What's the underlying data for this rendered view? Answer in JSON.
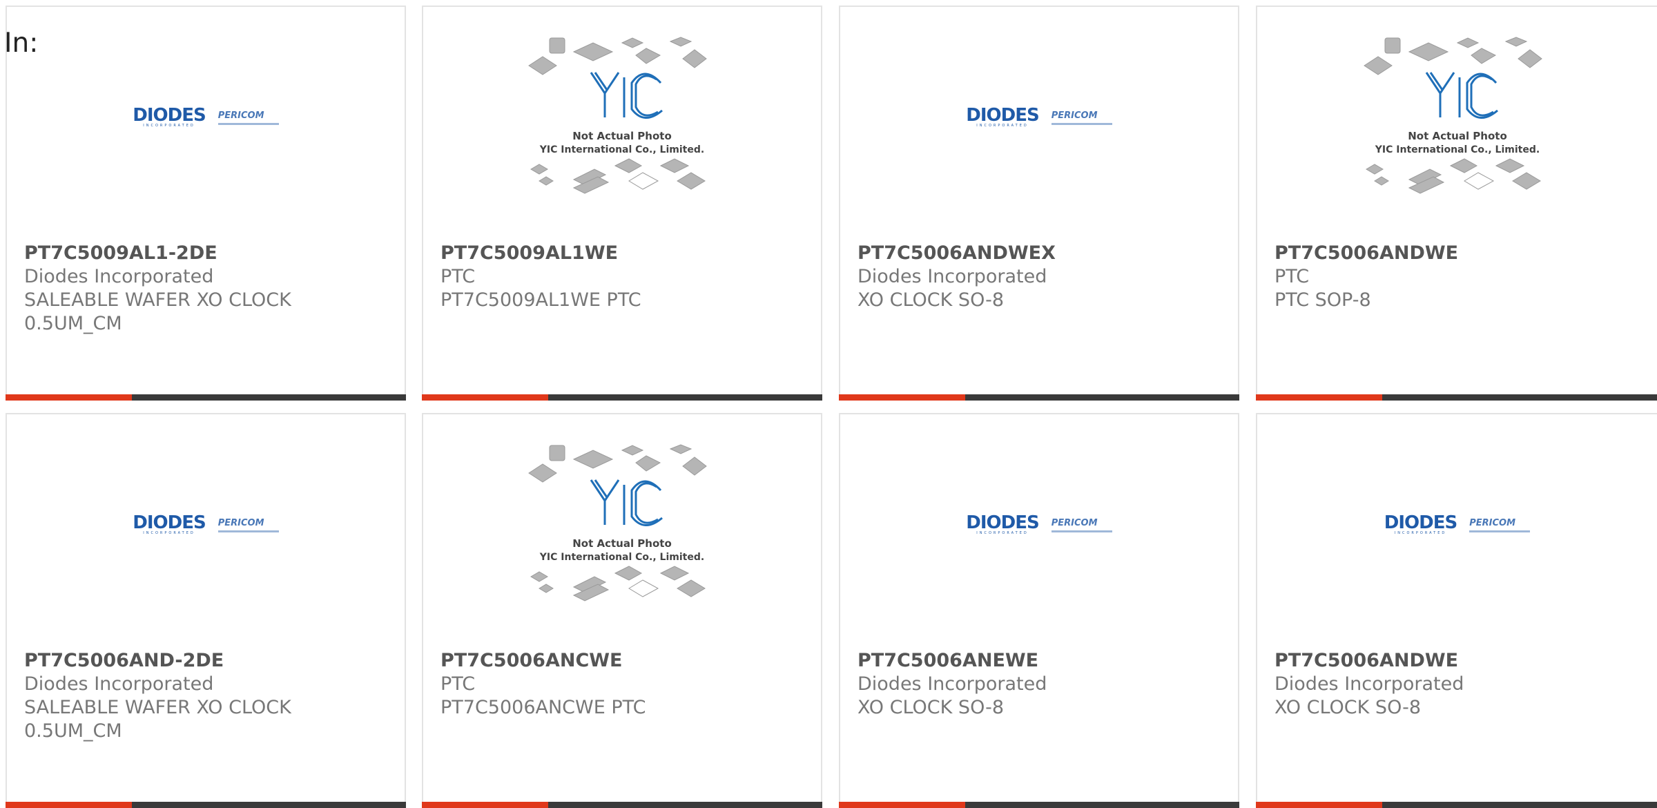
{
  "page": {
    "filter_label": "In:"
  },
  "colors": {
    "accent": "#e0381b",
    "bar": "#3a3a3a",
    "logo_blue": "#1f5aa8"
  },
  "logos": {
    "diodes": {
      "word": "DIODES",
      "sub": "INCORPORATED",
      "partner": "PERICOM"
    },
    "yic": {
      "mark": "YIC",
      "line1": "Not Actual Photo",
      "line2": "YIC International Co., Limited."
    }
  },
  "products": [
    {
      "part_number": "PT7C5009AL1-2DE",
      "manufacturer": "Diodes Incorporated",
      "description": "SALEABLE WAFER XO CLOCK 0.5UM_CM",
      "image": "diodes-logo"
    },
    {
      "part_number": "PT7C5009AL1WE",
      "manufacturer": "PTC",
      "description": "PT7C5009AL1WE PTC",
      "image": "yic-placeholder"
    },
    {
      "part_number": "PT7C5006ANDWEX",
      "manufacturer": "Diodes Incorporated",
      "description": "XO CLOCK SO-8",
      "image": "diodes-logo"
    },
    {
      "part_number": "PT7C5006ANDWE",
      "manufacturer": "PTC",
      "description": "PTC SOP-8",
      "image": "yic-placeholder"
    },
    {
      "part_number": "PT7C5006AND-2DE",
      "manufacturer": "Diodes Incorporated",
      "description": "SALEABLE WAFER XO CLOCK 0.5UM_CM",
      "image": "diodes-logo"
    },
    {
      "part_number": "PT7C5006ANCWE",
      "manufacturer": "PTC",
      "description": "PT7C5006ANCWE PTC",
      "image": "yic-placeholder"
    },
    {
      "part_number": "PT7C5006ANEWE",
      "manufacturer": "Diodes Incorporated",
      "description": "XO CLOCK SO-8",
      "image": "diodes-logo"
    },
    {
      "part_number": "PT7C5006ANDWE",
      "manufacturer": "Diodes Incorporated",
      "description": "XO CLOCK SO-8",
      "image": "diodes-logo"
    }
  ]
}
